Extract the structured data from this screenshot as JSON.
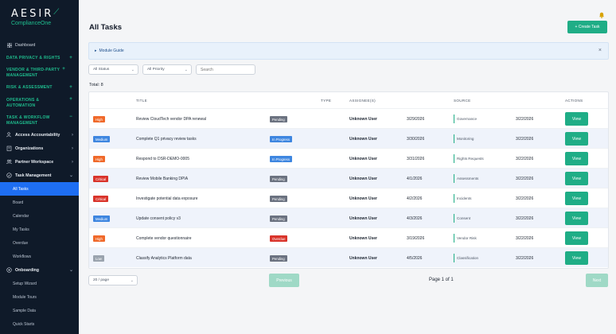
{
  "brand": {
    "name": "AESIR",
    "sub": "ComplianceOne"
  },
  "colors": {
    "sidebar": "#0f1a29",
    "accent": "#1fad86",
    "active": "#1e6ef2",
    "high": "#f0692a",
    "medium": "#3e86e0",
    "critical": "#d9342b",
    "low": "#9aa3ae",
    "pending": "#6b7280",
    "in_progress": "#3e86e0",
    "overdue": "#d9342b"
  },
  "sidebar": {
    "dashboard": "Dashboard",
    "sections": [
      "DATA PRIVACY & RIGHTS",
      "VENDOR & THIRD-PARTY MANAGEMENT",
      "RISK & ASSESSMENT",
      "OPERATIONS & AUTOMATION",
      "TASK & WORKFLOW MANAGEMENT"
    ],
    "groups": [
      "Access Accountability",
      "Organizations",
      "Partner Workspace",
      "Task Management"
    ],
    "task_items": [
      "All Tasks",
      "Board",
      "Calendar",
      "My Tasks",
      "Overdue",
      "Workflows"
    ],
    "onboarding": "Onboarding",
    "onboarding_items": [
      "Setup Wizard",
      "Module Tours",
      "Sample Data",
      "Quick Starts"
    ]
  },
  "header": {
    "title": "All Tasks",
    "create_label": "+ Create Task"
  },
  "guide": {
    "label": "Module Guide",
    "close": "×"
  },
  "filters": {
    "status": "All Status",
    "priority": "All Priority",
    "search_placeholder": "Search"
  },
  "total": "Total: 8",
  "table": {
    "headers": {
      "title": "TITLE",
      "type": "TYPE",
      "assignee": "ASSIGNEE(S)",
      "source": "SOURCE",
      "actions": "ACTIONS"
    },
    "view_label": "View",
    "rows": [
      {
        "priority": "High",
        "title": "Review CloudTech vendor DPA renewal",
        "status": "Pending",
        "assignee": "Unknown User",
        "due": "3/29/2026",
        "source": "Governance",
        "created": "3/22/2026"
      },
      {
        "priority": "Medium",
        "title": "Complete Q1 privacy review tasks",
        "status": "In Progress",
        "assignee": "Unknown User",
        "due": "3/30/2026",
        "source": "Monitoring",
        "created": "3/22/2026"
      },
      {
        "priority": "High",
        "title": "Respond to DSR-DEMO-0005",
        "status": "In Progress",
        "assignee": "Unknown User",
        "due": "3/31/2026",
        "source": "Rights Requests",
        "created": "3/22/2026"
      },
      {
        "priority": "Critical",
        "title": "Review Mobile Banking DPIA",
        "status": "Pending",
        "assignee": "Unknown User",
        "due": "4/1/2026",
        "source": "Assessments",
        "created": "3/22/2026"
      },
      {
        "priority": "Critical",
        "title": "Investigate potential data exposure",
        "status": "Pending",
        "assignee": "Unknown User",
        "due": "4/2/2026",
        "source": "Incidents",
        "created": "3/22/2026"
      },
      {
        "priority": "Medium",
        "title": "Update consent policy v3",
        "status": "Pending",
        "assignee": "Unknown User",
        "due": "4/3/2026",
        "source": "Consent",
        "created": "3/22/2026"
      },
      {
        "priority": "High",
        "title": "Complete vendor questionnaire",
        "status": "Overdue",
        "assignee": "Unknown User",
        "due": "3/19/2026",
        "source": "Vendor Risk",
        "created": "3/22/2026"
      },
      {
        "priority": "Low",
        "title": "Classify Analytics Platform data",
        "status": "Pending",
        "assignee": "Unknown User",
        "due": "4/5/2026",
        "source": "Classification",
        "created": "3/22/2026"
      }
    ]
  },
  "pagination": {
    "per_page": "20 / page",
    "previous": "Previous",
    "info": "Page 1 of 1",
    "next": "Next"
  }
}
